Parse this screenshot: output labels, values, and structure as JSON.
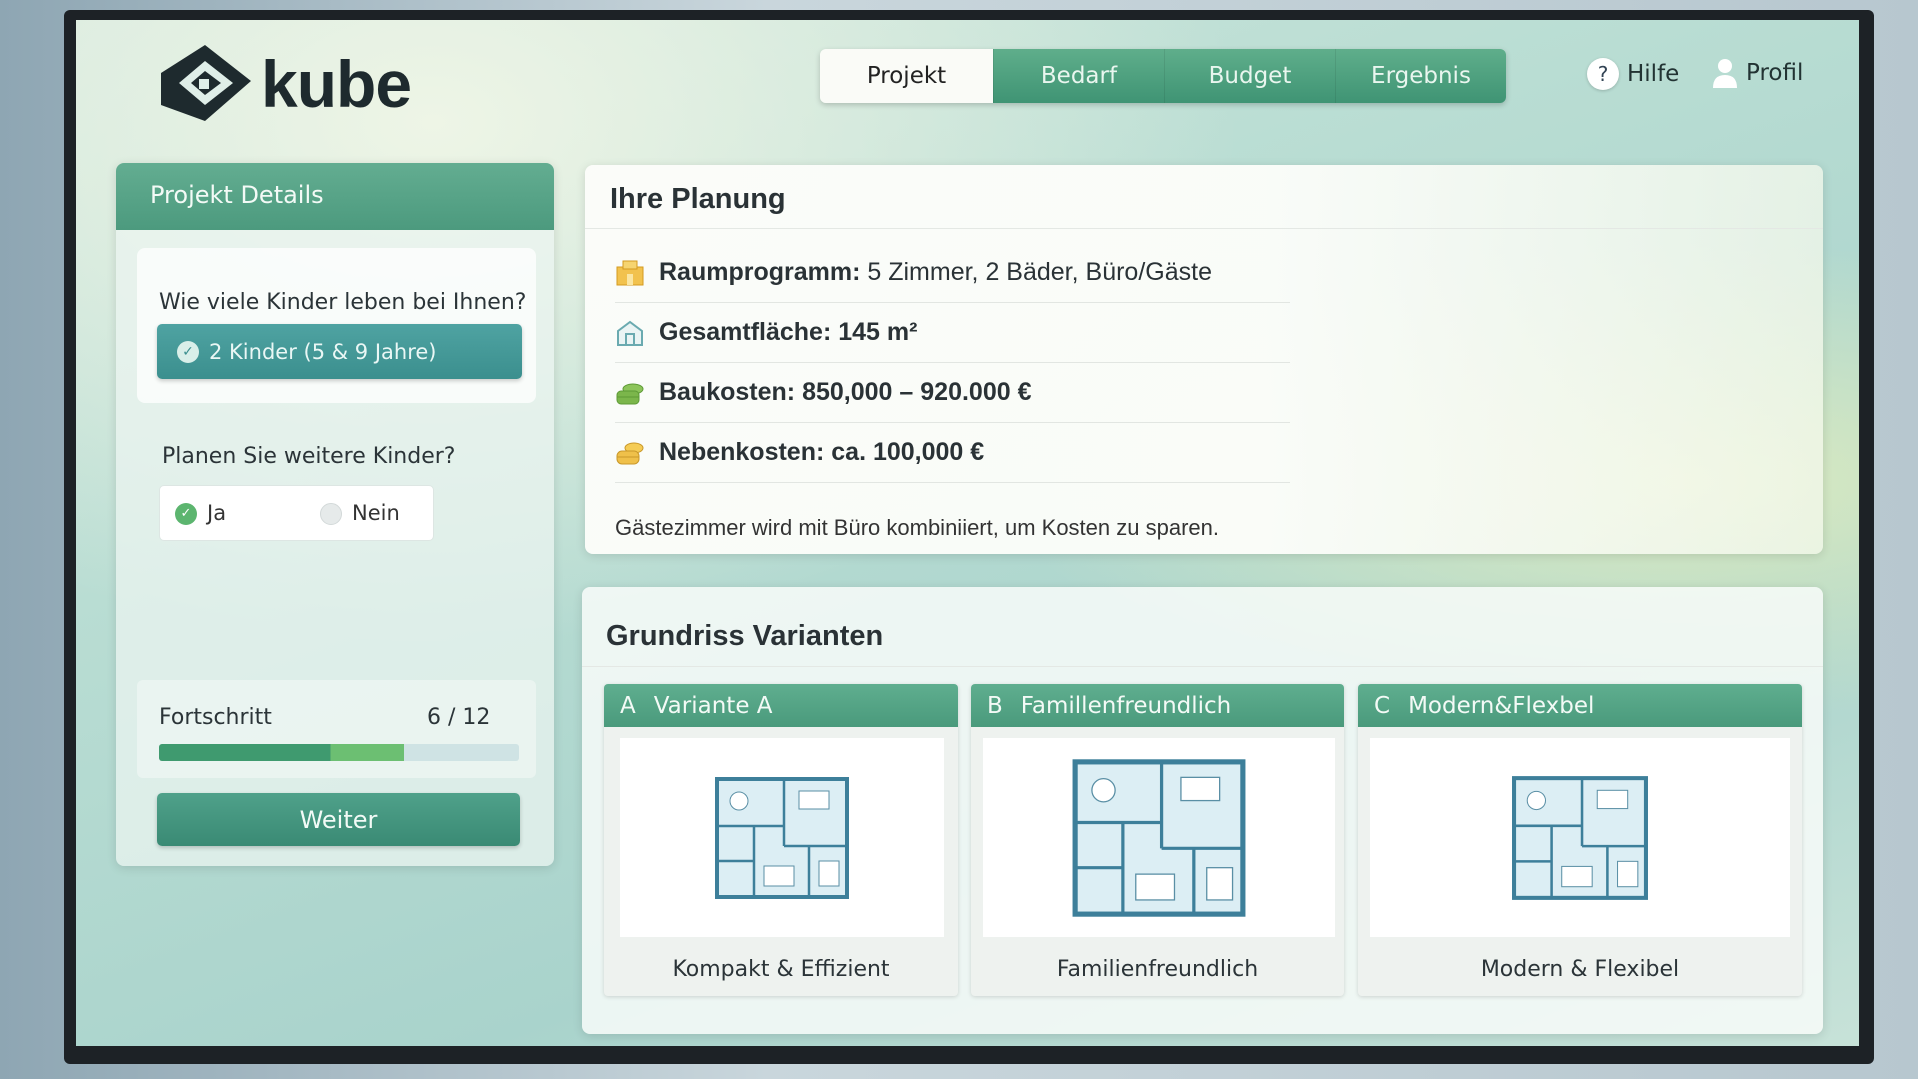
{
  "app": {
    "name": "kube"
  },
  "nav": {
    "tabs": [
      {
        "label": "Projekt",
        "active": true
      },
      {
        "label": "Bedarf"
      },
      {
        "label": "Budget"
      },
      {
        "label": "Ergebnis"
      }
    ],
    "help": "Hilfe",
    "profile": "Profil"
  },
  "sidebar": {
    "title": "Projekt Details",
    "question1": "Wie viele Kinder leben bei Ihnen?",
    "answer1": "2 Kinder (5 & 9 Jahre)",
    "question2": "Planen Sie weitere Kinder?",
    "option_yes": "Ja",
    "option_no": "Nein",
    "selected": "Ja",
    "progress_label": "Fortschritt",
    "progress_text": "6 / 12",
    "progress_fraction": 0.5,
    "next_button": "Weiter"
  },
  "planning": {
    "title": "Ihre Planung",
    "rows": [
      {
        "icon": "building-icon",
        "label": "Raumprogramm:",
        "value": "5 Zimmer, 2 Bäder, Büro/Gäste"
      },
      {
        "icon": "house-icon",
        "label": "Gesamtfläche:",
        "value": "145 m²"
      },
      {
        "icon": "money-stack-icon",
        "label": "Baukosten:",
        "value": "850,000 – 920.000 €"
      },
      {
        "icon": "coins-icon",
        "label": "Nebenkosten:",
        "value": "ca. 100,000 €"
      }
    ],
    "note": "Gästezimmer wird mit Büro kombiniiert, um Kosten zu sparen."
  },
  "variants": {
    "title": "Grundriss Varianten",
    "cards": [
      {
        "letter": "A",
        "title": "Variante A",
        "caption": "Kompakt & Effizient"
      },
      {
        "letter": "B",
        "title": "Famillenfreundlich",
        "caption": "Familienfreundlich"
      },
      {
        "letter": "C",
        "title": "Modern&Flexbel",
        "caption": "Modern & Flexibel"
      }
    ]
  },
  "colors": {
    "accent": "#4a9a7c",
    "teal": "#3b8f8e"
  }
}
